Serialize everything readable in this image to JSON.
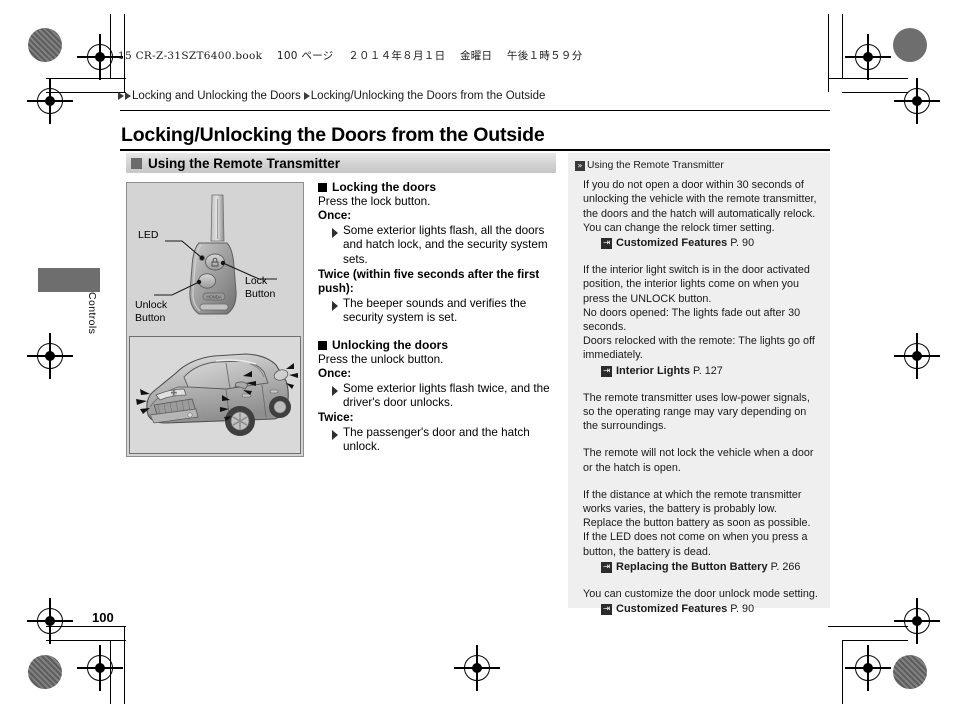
{
  "print_header": {
    "file_line": "15 CR-Z-31SZT6400.book",
    "page_jp": "100 ページ",
    "date_jp": "２０１４年８月１日",
    "weekday_jp": "金曜日",
    "time_jp": "午後１時５９分"
  },
  "breadcrumb": {
    "level1": "Locking and Unlocking the Doors",
    "level2": "Locking/Unlocking the Doors from the Outside"
  },
  "page_title": "Locking/Unlocking the Doors from the Outside",
  "section_header": "Using the Remote Transmitter",
  "illustration": {
    "callouts": {
      "led": "LED",
      "lock": "Lock\nButton",
      "lock_line1": "Lock",
      "lock_line2": "Button",
      "unlock_line1": "Unlock",
      "unlock_line2": "Button"
    },
    "fob_alt": "remote-transmitter-key-fob",
    "car_alt": "honda-cr-z-exterior-lights-flashing"
  },
  "instructions": [
    {
      "heading": "Locking the doors",
      "intro": "Press the lock button.",
      "steps": [
        {
          "label": "Once:",
          "text": "Some exterior lights flash, all the doors and hatch lock, and the security system sets."
        },
        {
          "label": "Twice (within five seconds after the first push):",
          "text": "The beeper sounds and verifies the security system is set."
        }
      ]
    },
    {
      "heading": "Unlocking the doors",
      "intro": "Press the unlock button.",
      "steps": [
        {
          "label": "Once:",
          "text": "Some exterior lights flash twice, and the driver's door unlocks."
        },
        {
          "label": "Twice:",
          "text": "The passenger's door and the hatch unlock."
        }
      ]
    }
  ],
  "notes": {
    "title": "Using the Remote Transmitter",
    "blocks": [
      {
        "text": "If you do not open a door within 30 seconds of unlocking the vehicle with the remote transmitter, the doors and the hatch will automatically relock. You can change the relock timer setting.",
        "xref": {
          "name": "Customized Features",
          "page": "P. 90"
        }
      },
      {
        "text": "If the interior light switch is in the door activated position, the interior lights come on when you press the UNLOCK button.\nNo doors opened: The lights fade out after 30 seconds.\nDoors relocked with the remote: The lights go off immediately.",
        "xref": {
          "name": "Interior Lights",
          "page": "P. 127"
        }
      },
      {
        "text": "The remote transmitter uses low-power signals, so the operating range may vary depending on the surroundings.",
        "xref": null
      },
      {
        "text": "The remote will not lock the vehicle when a door or the hatch is open.",
        "xref": null
      },
      {
        "text": "If the distance at which the remote transmitter works varies, the battery is probably low. Replace the button battery as soon as possible.\nIf the LED does not come on when you press a button, the battery is dead.",
        "xref": {
          "name": "Replacing the Button Battery",
          "page": "P. 266"
        }
      },
      {
        "text": "You can customize the door unlock mode setting.",
        "xref": {
          "name": "Customized Features",
          "page": "P. 90"
        }
      }
    ]
  },
  "margin_tab": "Controls",
  "page_number": "100",
  "icons": {
    "breadcrumb_arrow": "triangle-right-icon",
    "note_marker": "double-chevron-icon",
    "xref_marker": "cross-reference-arrow-icon"
  },
  "colors": {
    "illustration_bg": "#d4d4d4",
    "notes_bg": "#efefef",
    "tab_block": "#6e6e6e",
    "section_bar": "#d2d2d2"
  }
}
